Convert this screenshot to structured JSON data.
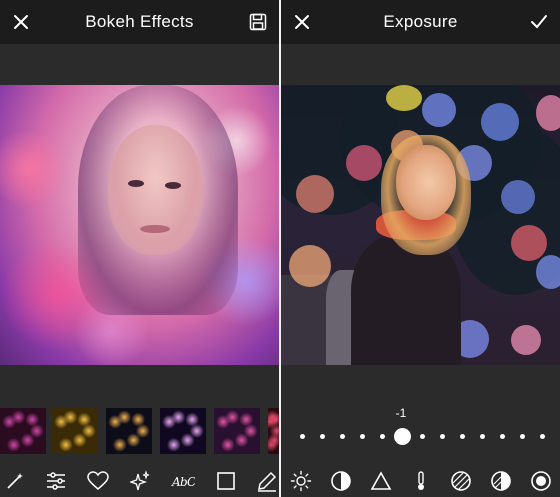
{
  "left_screen": {
    "title": "Bokeh Effects",
    "close_icon": "close-icon",
    "save_icon": "save-icon",
    "thumbnails": [
      {
        "name": "bokeh-thumb-purple-dots",
        "colors": [
          "#2a0b20",
          "#d049a8"
        ]
      },
      {
        "name": "bokeh-thumb-gold",
        "colors": [
          "#3a2a05",
          "#f2c044"
        ]
      },
      {
        "name": "bokeh-thumb-night-lights",
        "colors": [
          "#0c0d18",
          "#f2b050"
        ]
      },
      {
        "name": "bokeh-thumb-multicolor",
        "colors": [
          "#100820",
          "#e7a7f2"
        ]
      },
      {
        "name": "bokeh-thumb-pink",
        "colors": [
          "#2a1030",
          "#e055a4"
        ]
      },
      {
        "name": "bokeh-thumb-red",
        "colors": [
          "#2a0a12",
          "#e04a6a"
        ]
      }
    ],
    "tools": [
      "magic-wand-icon",
      "adjust-sliders-icon",
      "heart-icon",
      "sparkles-icon",
      "text-abc-icon",
      "square-frame-icon",
      "pencil-icon"
    ]
  },
  "right_screen": {
    "title": "Exposure",
    "close_icon": "close-icon",
    "confirm_icon": "checkmark-icon",
    "slider": {
      "value_label": "-1",
      "selected_index": 5,
      "dot_count": 13
    },
    "tools": [
      "brightness-icon",
      "contrast-icon",
      "triangle-icon",
      "thermometer-icon",
      "hatched-circle-icon",
      "half-hatched-circle-icon",
      "vignette-circle-icon"
    ]
  },
  "colors": {
    "background": "#2b2b2b",
    "topbar": "#1c1c1c",
    "foreground": "#ffffff"
  }
}
